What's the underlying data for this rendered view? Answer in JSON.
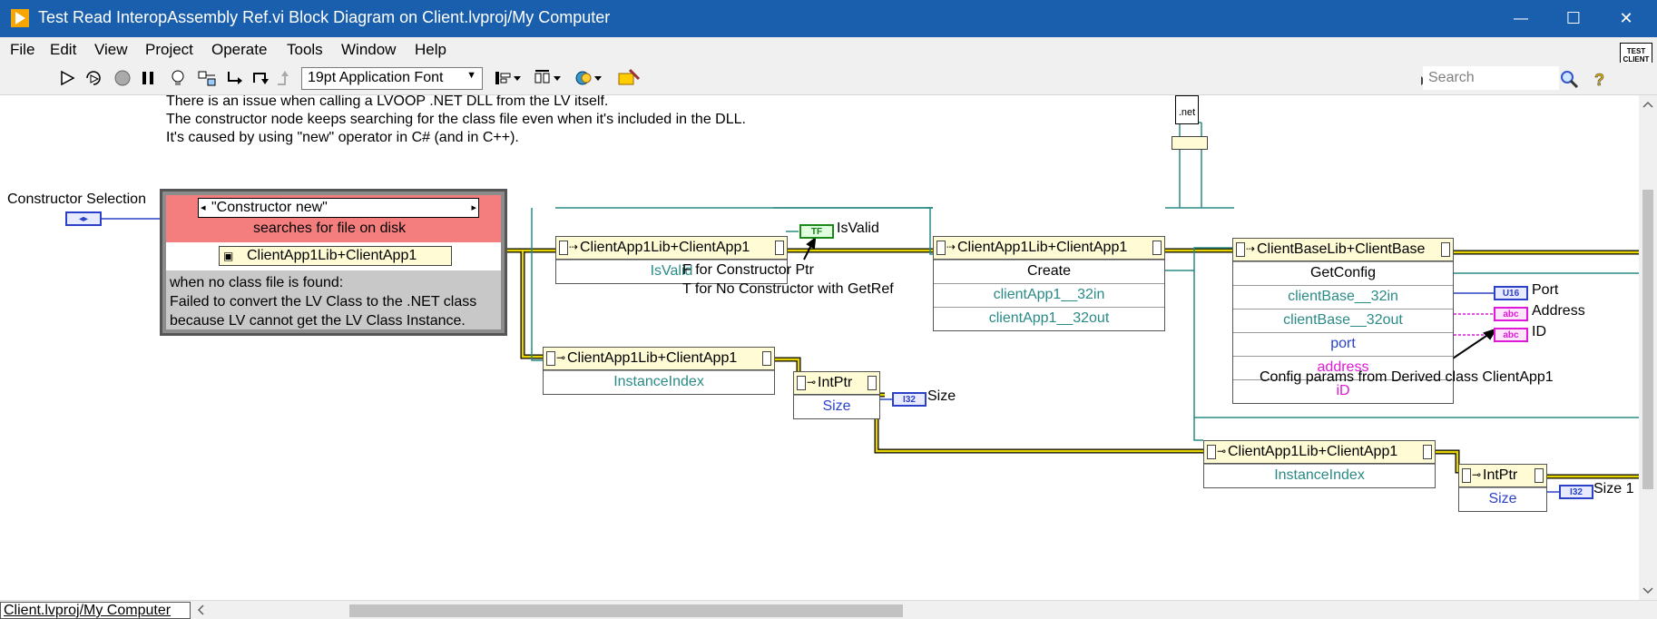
{
  "window": {
    "title": "Test Read InteropAssembly Ref.vi Block Diagram on Client.lvproj/My Computer",
    "minimize_glyph": "—",
    "maximize_glyph": "☐",
    "close_glyph": "✕"
  },
  "menu": [
    "File",
    "Edit",
    "View",
    "Project",
    "Operate",
    "Tools",
    "Window",
    "Help"
  ],
  "toolbar": {
    "font": "19pt Application Font",
    "search_placeholder": "Search",
    "vi_icon_text": "TEST CLIENT DLL READ",
    "icons": [
      "run-arrow-icon",
      "highlight-execution-icon",
      "abort-icon",
      "pause-icon",
      "lightbulb-icon",
      "retain-wire-values-icon",
      "step-into-icon",
      "step-over-icon",
      "step-out-icon",
      "text-settings-icon",
      "align-objects-icon",
      "distribute-objects-icon",
      "reorder-icon",
      "cleanup-diagram-icon",
      "search-icon",
      "help-icon"
    ]
  },
  "diagram": {
    "comment_lines": [
      "There is an issue when calling a LVOOP .NET DLL from the LV itself.",
      "The constructor node keeps searching for the class file even when it's included in the DLL.",
      "It's  caused by using \"new\" operator in C# (and in C++)."
    ],
    "constructor_selection_label": "Constructor Selection",
    "case_structure": {
      "selector": "\"Constructor new\"",
      "top_text": "searches for file on disk",
      "class_ref": "ClientApp1Lib+ClientApp1",
      "bottom_lines": [
        "when no class file is found:",
        "Failed to convert the LV Class to the .NET class",
        "because LV cannot get the LV Class Instance."
      ]
    },
    "property_node_isvalid": {
      "class": "ClientApp1Lib+ClientApp1",
      "rows": [
        "IsValid"
      ]
    },
    "isvalid_indicator": {
      "type": "TF",
      "label": "IsValid"
    },
    "constructor_note": [
      "F for Constructor Ptr",
      "T for No Constructor with GetRef"
    ],
    "invoke_create": {
      "class": "ClientApp1Lib+ClientApp1",
      "rows": [
        "Create",
        "clientApp1__32in",
        "clientApp1__32out"
      ]
    },
    "invoke_getconfig": {
      "class": "ClientBaseLib+ClientBase",
      "rows": [
        "GetConfig",
        "clientBase__32in",
        "clientBase__32out",
        "port",
        "address",
        "iD"
      ]
    },
    "indicators": [
      {
        "type": "U16",
        "label": "Port"
      },
      {
        "type": "abc",
        "label": "Address"
      },
      {
        "type": "abc",
        "label": "ID"
      }
    ],
    "config_note": "Config params from Derived class ClientApp1",
    "dotnet_label": ".net",
    "property_instance_index_1": {
      "class": "ClientApp1Lib+ClientApp1",
      "rows": [
        "InstanceIndex"
      ]
    },
    "intptr_1": {
      "class": "IntPtr",
      "rows": [
        "Size"
      ]
    },
    "size_indicator_1": {
      "type": "I32",
      "label": "Size"
    },
    "property_instance_index_2": {
      "class": "ClientApp1Lib+ClientApp1",
      "rows": [
        "InstanceIndex"
      ]
    },
    "intptr_2": {
      "class": "IntPtr",
      "rows": [
        "Size"
      ]
    },
    "size_indicator_2": {
      "type": "I32",
      "label": "Size 1"
    },
    "ring_control_glyph": "◂▸"
  },
  "status": {
    "context": "Client.lvproj/My Computer"
  },
  "colors": {
    "titlebar": "#1a5fad",
    "property_header": "#fffbd5",
    "case_red": "#f47e7e",
    "ref_wire": "#2a8a86",
    "class_wire": "#c8b400",
    "int_wire": "#2b42c8",
    "string_wire": "#e018d8"
  }
}
